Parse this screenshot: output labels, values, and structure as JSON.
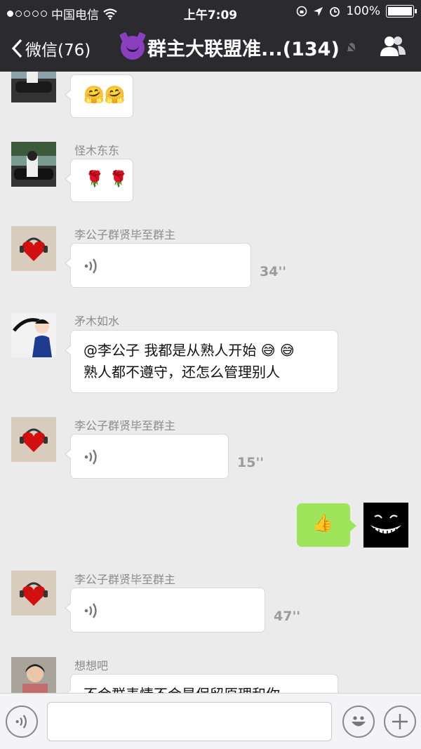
{
  "status_bar": {
    "carrier": "中国电信",
    "time": "上午7:09",
    "battery": "100%"
  },
  "nav": {
    "back_label": "微信(76)",
    "title": "群主大联盟准...(134)"
  },
  "messages": [
    {
      "sender": "",
      "content": "🤗🤗"
    },
    {
      "sender": "怪木东东",
      "content": "🌹 🌹"
    },
    {
      "sender": "李公子群贤毕至群主",
      "type": "voice",
      "duration": "34''"
    },
    {
      "sender": "矛木如水",
      "text_line1": "@李公子 我都是从熟人开始 😅 😅",
      "text_line2": "熟人都不遵守，还怎么管理别人"
    },
    {
      "sender": "李公子群贤毕至群主",
      "type": "voice",
      "duration": "15''"
    },
    {
      "sender": "me",
      "content": "👍"
    },
    {
      "sender": "李公子群贤毕至群主",
      "type": "voice",
      "duration": "47''"
    },
    {
      "sender": "想想吧",
      "text_line1": "不会群表情不会是保留原理和你"
    }
  ]
}
